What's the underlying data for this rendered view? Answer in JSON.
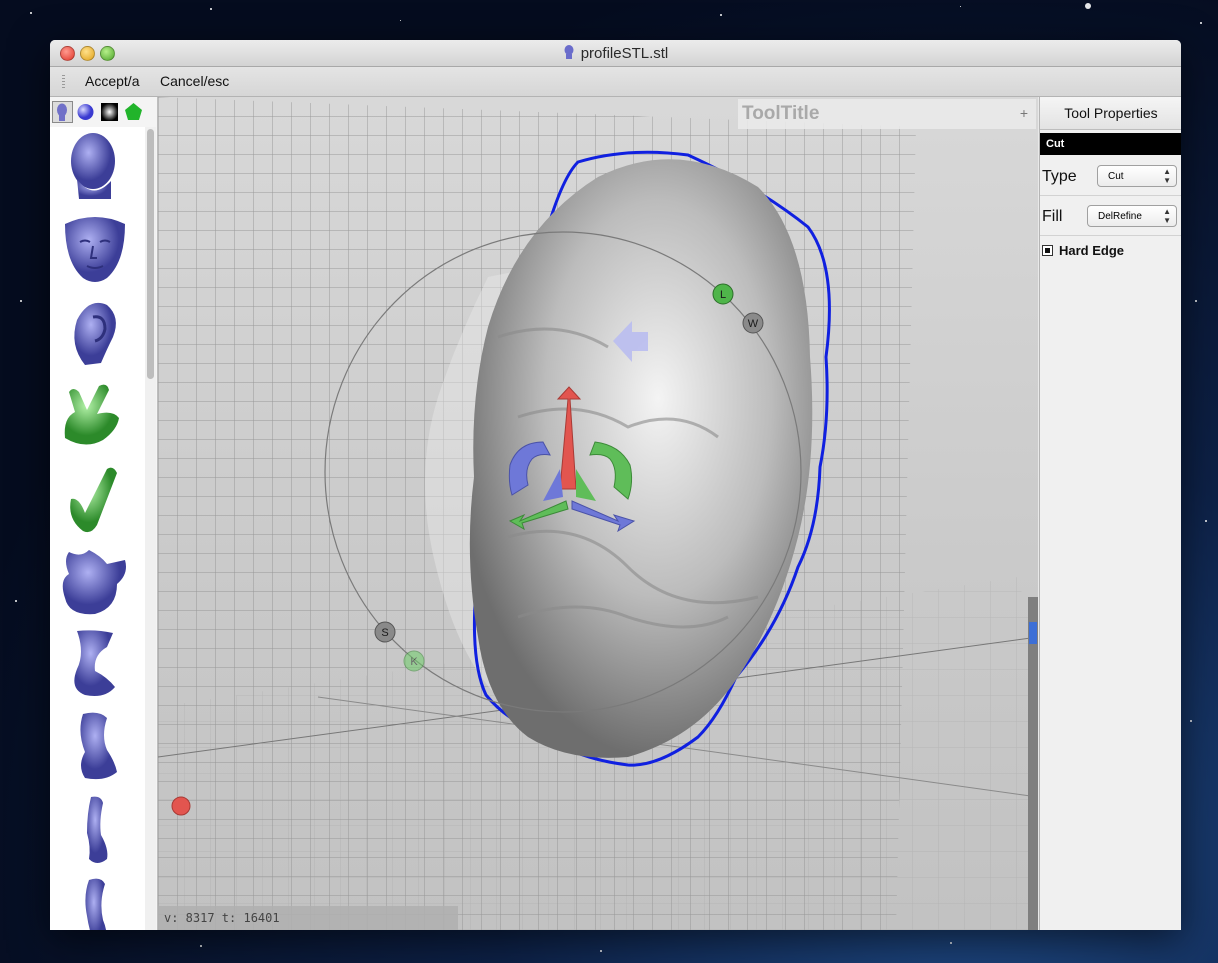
{
  "window": {
    "title": "profileSTL.stl"
  },
  "toolbar": {
    "accept_label": "Accept/a",
    "cancel_label": "Cancel/esc"
  },
  "library": {
    "tabs": [
      {
        "name": "head-library-icon",
        "color": "#7070c8"
      },
      {
        "name": "sphere-library-icon",
        "color": "#6a6ae0"
      },
      {
        "name": "gradient-library-icon",
        "color": "#000000"
      },
      {
        "name": "pentagon-library-icon",
        "color": "#21b42b"
      }
    ],
    "thumbnails": [
      {
        "name": "head-thumbnail-icon",
        "color": "#6a6ccb"
      },
      {
        "name": "face-thumbnail-icon",
        "color": "#6a6ccb"
      },
      {
        "name": "ear-thumbnail-icon",
        "color": "#6a6ccb"
      },
      {
        "name": "hand-peace-thumbnail-icon",
        "color": "#5ecb5a"
      },
      {
        "name": "hand-flat-thumbnail-icon",
        "color": "#48b040"
      },
      {
        "name": "creature-thumbnail-icon",
        "color": "#6a6ccb"
      },
      {
        "name": "foot-thumbnail-icon",
        "color": "#6a6ccb"
      },
      {
        "name": "leg-thumbnail-icon",
        "color": "#6a6ccb"
      },
      {
        "name": "arm-thumbnail-icon",
        "color": "#6a6ccb"
      },
      {
        "name": "leg2-thumbnail-icon",
        "color": "#6a6ccb"
      }
    ]
  },
  "viewport": {
    "tool_title": "ToolTitle",
    "tool_title_plus": "+",
    "status": "v: 8317 t: 16401",
    "gizmo_labels": {
      "l": "L",
      "w": "W",
      "s": "S",
      "k": "K"
    }
  },
  "tool_properties": {
    "header": "Tool Properties",
    "tool_name": "Cut",
    "type_label": "Type",
    "type_value": "Cut",
    "fill_label": "Fill",
    "fill_value": "DelRefine",
    "hard_edge_label": "Hard Edge",
    "hard_edge_checked": true
  },
  "colors": {
    "outline_blue": "#1020e0",
    "gizmo_red": "#e2554f",
    "gizmo_green": "#4fb54a",
    "gizmo_blue": "#6e78d8",
    "mesh": "#bdbdbd"
  }
}
